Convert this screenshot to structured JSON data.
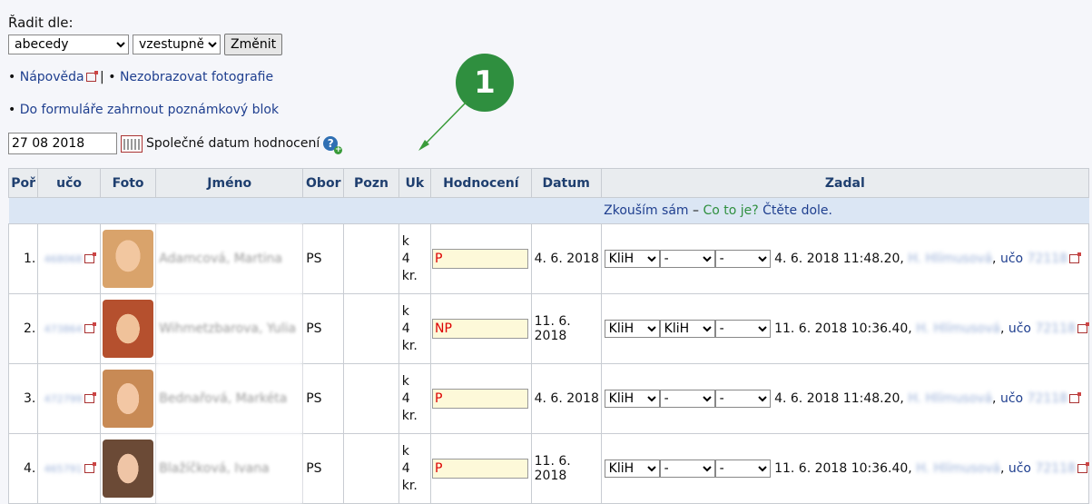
{
  "sort": {
    "label": "Řadit dle:",
    "field_value": "abecedy",
    "order_value": "vzestupně",
    "button": "Změnit"
  },
  "links": {
    "help": "Nápověda",
    "separator": "|",
    "no_photos": "Nezobrazovat fotografie",
    "notes_block": "Do formuláře zahrnout poznámkový blok"
  },
  "common_date": {
    "value": "27 08 2018",
    "label": "Společné datum hodnocení"
  },
  "callout": "1",
  "table": {
    "headers": [
      "Poř",
      "učo",
      "Foto",
      "Jméno",
      "Obor",
      "Pozn",
      "Uk",
      "Hodnocení",
      "Datum",
      "Zadal"
    ],
    "info_row": {
      "text1": "Zkouším sám",
      "dash": " – ",
      "link2": "Co to je?",
      "text3": " Čtěte dole."
    },
    "rows": [
      {
        "n": "1.",
        "uco": "468068",
        "name": "Adamcová, Martina",
        "obor": "PS",
        "uk1": "k",
        "uk2": "4 kr.",
        "grade": "P",
        "date": "4. 6. 2018",
        "sel1": "KliH",
        "sel2": "-",
        "sel3": "-",
        "zadal": "4. 6. 2018 11:48.20,",
        "zadal_name": "H. Hlímusová",
        "uco_label": "učo",
        "zadal_uco": "72118"
      },
      {
        "n": "2.",
        "uco": "473864",
        "name": "Wihmetzbarova, Yulia",
        "obor": "PS",
        "uk1": "k",
        "uk2": "4 kr.",
        "grade": "NP",
        "date": "11. 6. 2018",
        "sel1": "KliH",
        "sel2": "KliH",
        "sel3": "-",
        "zadal": "11. 6. 2018 10:36.40,",
        "zadal_name": "H. Hlímusová",
        "uco_label": "učo",
        "zadal_uco": "72118"
      },
      {
        "n": "3.",
        "uco": "472799",
        "name": "Bednařová, Markéta",
        "obor": "PS",
        "uk1": "k",
        "uk2": "4 kr.",
        "grade": "P",
        "date": "4. 6. 2018",
        "sel1": "KliH",
        "sel2": "-",
        "sel3": "-",
        "zadal": "4. 6. 2018 11:48.20,",
        "zadal_name": "H. Hlímusová",
        "uco_label": "učo",
        "zadal_uco": "72118"
      },
      {
        "n": "4.",
        "uco": "465791",
        "name": "Blažíčková, Ivana",
        "obor": "PS",
        "uk1": "k",
        "uk2": "4 kr.",
        "grade": "P",
        "date": "11. 6. 2018",
        "sel1": "KliH",
        "sel2": "-",
        "sel3": "-",
        "zadal": "11. 6. 2018 10:36.40,",
        "zadal_name": "H. Hlímusová",
        "uco_label": "učo",
        "zadal_uco": "72118"
      }
    ]
  },
  "colors": {
    "accent_green": "#2f8f3f",
    "link": "#1f3f8f",
    "header_text": "#1f3f6f",
    "grade_red": "#d00000"
  }
}
